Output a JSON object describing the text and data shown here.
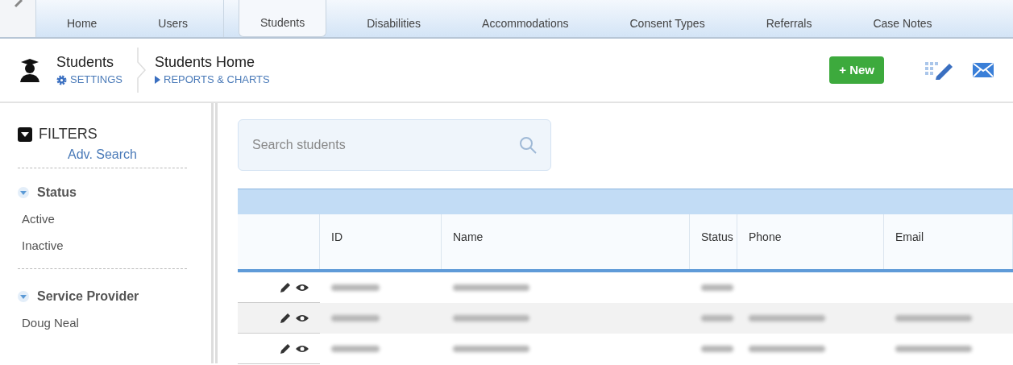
{
  "nav_tabs": [
    {
      "label": "Home",
      "selected": false
    },
    {
      "label": "Users",
      "selected": false
    },
    {
      "label": "Students",
      "selected": true
    },
    {
      "label": "Disabilities",
      "selected": false
    },
    {
      "label": "Accommodations",
      "selected": false
    },
    {
      "label": "Consent Types",
      "selected": false
    },
    {
      "label": "Referrals",
      "selected": false
    },
    {
      "label": "Case Notes",
      "selected": false
    }
  ],
  "header": {
    "module": "Students",
    "settings_link": "SETTINGS",
    "page_title": "Students Home",
    "reports_link": "REPORTS & CHARTS",
    "new_button": "+ New"
  },
  "filters": {
    "title": "FILTERS",
    "adv_search": "Adv. Search",
    "groups": [
      {
        "title": "Status",
        "expanded": true,
        "items": [
          "Active",
          "Inactive"
        ]
      },
      {
        "title": "Service Provider",
        "expanded": true,
        "items": [
          "Doug Neal"
        ]
      }
    ]
  },
  "search": {
    "placeholder": "Search students"
  },
  "table": {
    "columns": [
      "ID",
      "Name",
      "Status",
      "Phone",
      "Email"
    ],
    "rows": [
      {
        "redacted": [
          true,
          true,
          true,
          false,
          false
        ]
      },
      {
        "redacted": [
          true,
          true,
          true,
          true,
          true
        ]
      },
      {
        "redacted": [
          true,
          true,
          true,
          true,
          true
        ]
      }
    ]
  }
}
